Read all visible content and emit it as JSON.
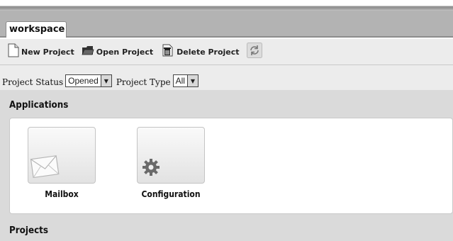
{
  "workspace_tab": {
    "label": "workspace"
  },
  "toolbar": {
    "new_project": "New Project",
    "open_project": "Open Project",
    "delete_project": "Delete Project",
    "refresh_icon": "refresh-icon"
  },
  "filters": {
    "status_label": "Project Status",
    "status_value": "Opened",
    "type_label": "Project Type",
    "type_value": "All"
  },
  "applications": {
    "title": "Applications",
    "items": [
      {
        "label": "Mailbox",
        "icon": "envelope-icon"
      },
      {
        "label": "Configuration",
        "icon": "gear-icon"
      }
    ]
  },
  "projects": {
    "title": "Projects"
  }
}
